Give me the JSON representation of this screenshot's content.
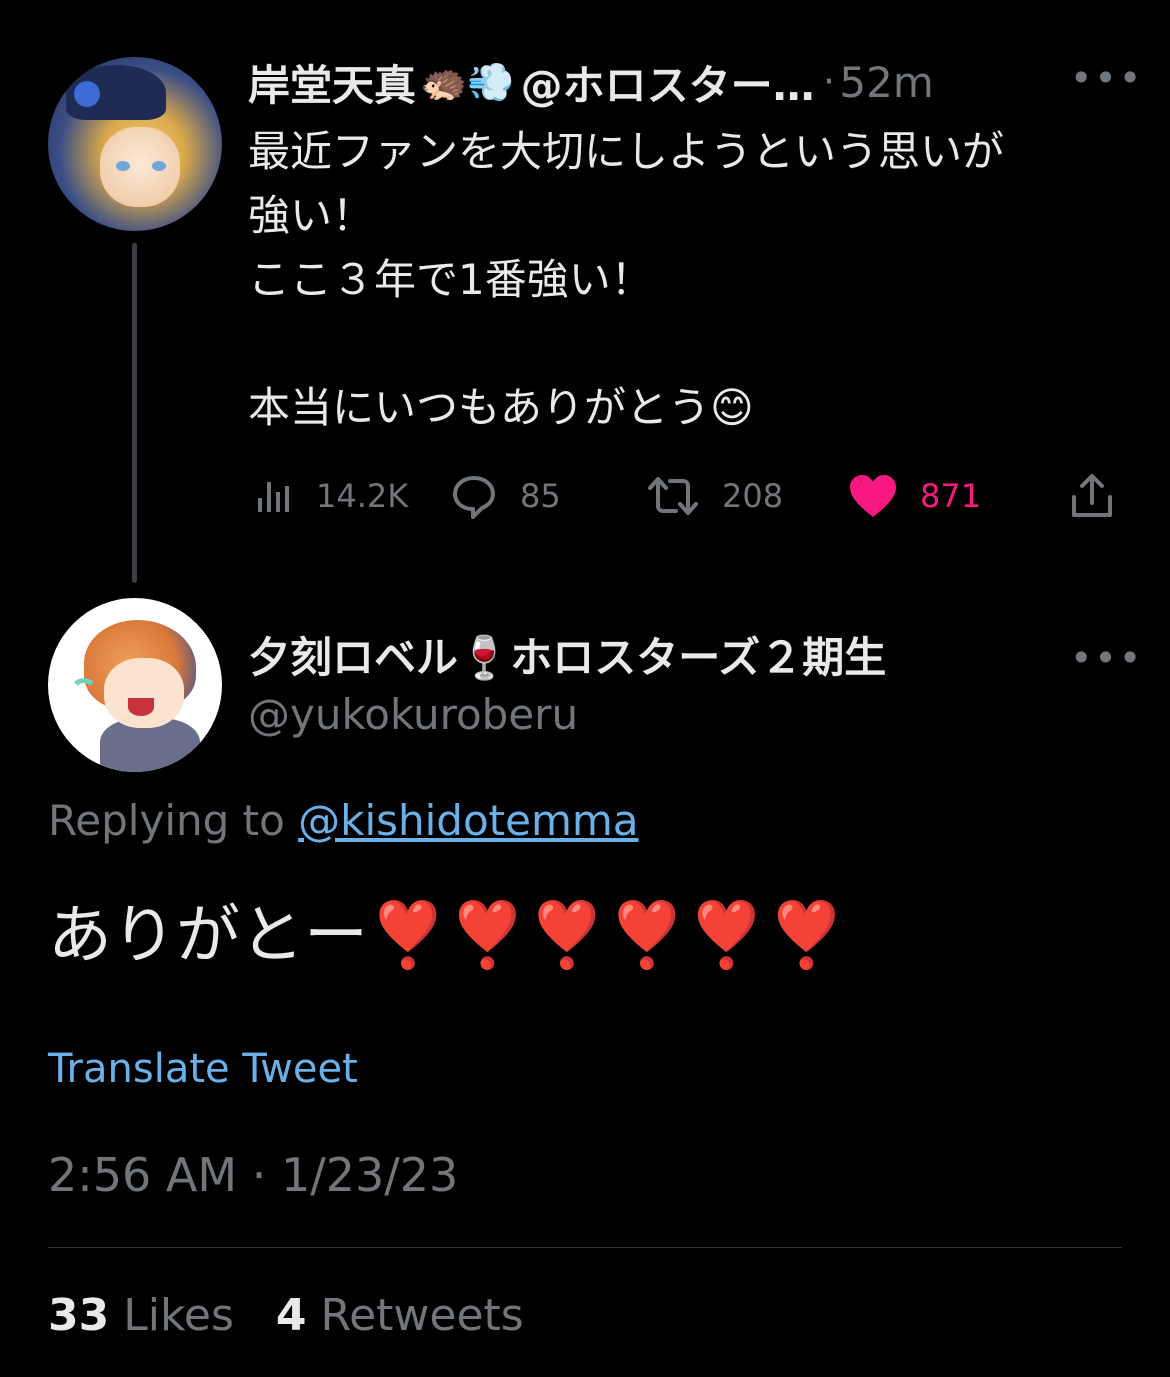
{
  "parent_tweet": {
    "display_name": "岸堂天真",
    "name_emojis": "🦔💨",
    "handle_truncated": "@ホロスター…",
    "separator": "·",
    "time_ago": "52m",
    "more_label": "•••",
    "text": "最近ファンを大切にしようという思いが\n強い！\nここ３年で1番強い！\n\n本当にいつもありがとう😊",
    "views": "14.2K",
    "replies": "85",
    "retweets": "208",
    "likes": "871",
    "liked": true,
    "colors": {
      "like": "#f91880",
      "muted": "#71767b"
    },
    "icons": [
      "views-icon",
      "reply-icon",
      "retweet-icon",
      "like-icon",
      "share-icon"
    ]
  },
  "reply_tweet": {
    "display_name": "夕刻ロベル🍷ホロスターズ２期生",
    "handle": "@yukokuroberu",
    "more_label": "•••",
    "replying_prefix": "Replying to ",
    "replying_mention": "@kishidotemma",
    "text": "ありがとー",
    "hearts": "❣️❣️❣️❣️❣️❣️",
    "translate_label": "Translate Tweet",
    "timestamp": "2:56 AM · 1/23/23",
    "likes_count": "33",
    "likes_word": "Likes",
    "retweets_count": "4",
    "retweets_word": "Retweets",
    "colors": {
      "link": "#6ab1ea",
      "heart": "#e0263a"
    }
  }
}
